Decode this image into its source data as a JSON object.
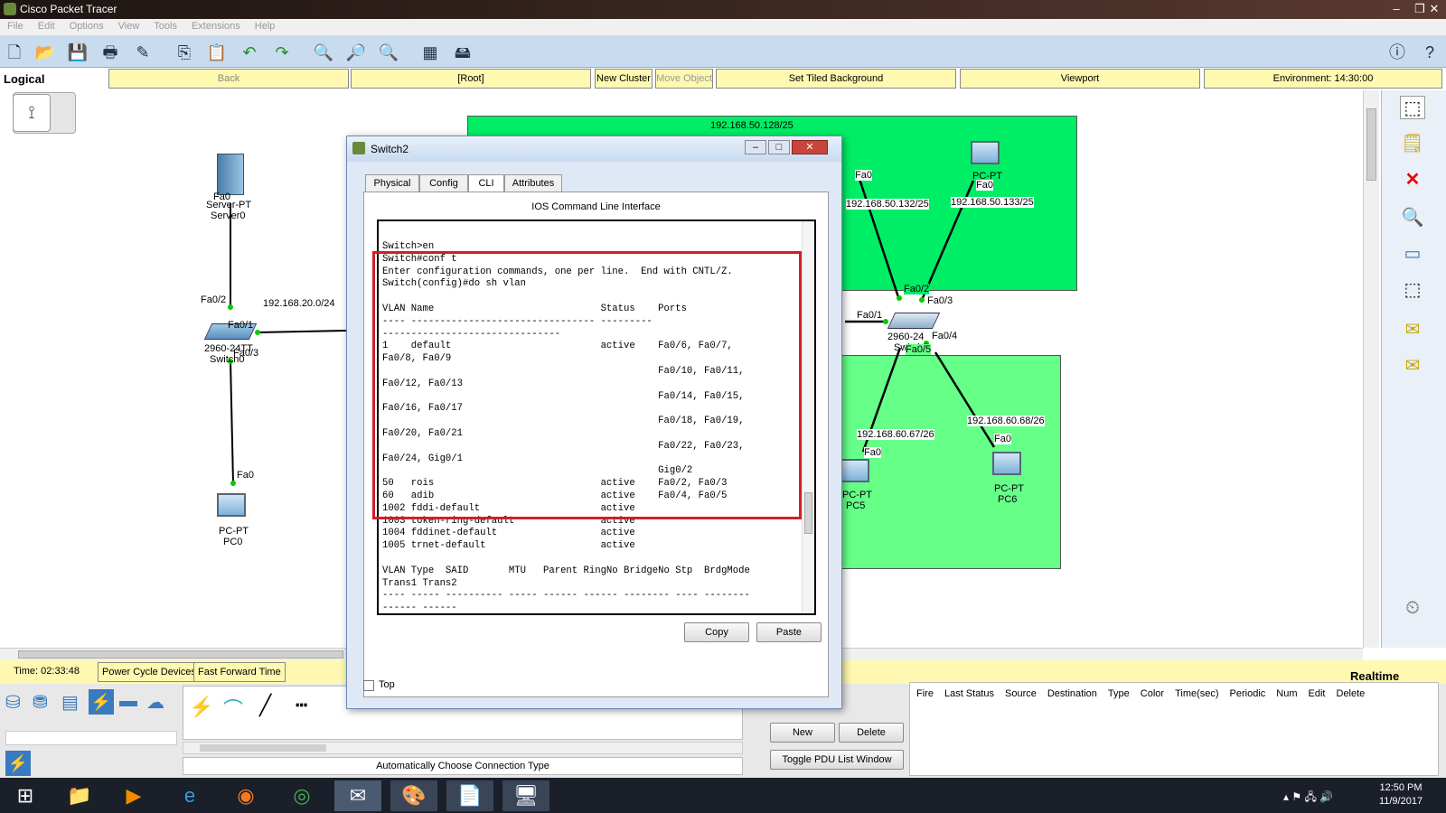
{
  "window": {
    "title": "Cisco Packet Tracer",
    "controls": [
      "–",
      "❐",
      "✕"
    ]
  },
  "menu": [
    "File",
    "Edit",
    "Options",
    "View",
    "Tools",
    "Extensions",
    "Help"
  ],
  "toolbar_icons": [
    "new-file-icon",
    "open-folder-icon",
    "save-icon",
    "print-icon",
    "activity-wizard-icon",
    "copy-icon",
    "paste-icon",
    "undo-icon",
    "redo-icon",
    "zoom-in-icon",
    "zoom-reset-icon",
    "zoom-out-icon",
    "palette-icon",
    "custom-device-icon",
    "info-icon",
    "help-icon"
  ],
  "workspace_bar": {
    "mode": "Logical",
    "back": "Back",
    "root": "[Root]",
    "new_cluster": "New Cluster",
    "move_object": "Move Object",
    "tiled_bg": "Set Tiled Background",
    "viewport": "Viewport",
    "environment": "Environment: 14:30:00"
  },
  "topology": {
    "server": {
      "port": "Fa0",
      "type": "Server-PT",
      "name": "Server0"
    },
    "switch0": {
      "port_fa02": "Fa0/2",
      "port_fa01": "Fa0/1",
      "port_fa03": "Fa0/3",
      "type": "2960-24TT",
      "name": "Switch0",
      "net": "192.168.20.0/24"
    },
    "pc0": {
      "port": "Fa0",
      "type": "PC-PT",
      "name": "PC0"
    },
    "zone_top_net": "192.168.50.128/25",
    "pc_top_left": {
      "port": "Fa0",
      "ip": "192.168.50.132/25"
    },
    "pc_top_right": {
      "port": "Fa0",
      "type": "PC-PT",
      "ip": "192.168.50.133/25"
    },
    "switch2": {
      "fa02": "Fa0/2",
      "fa03": "Fa0/3",
      "fa01": "Fa0/1",
      "fa04": "Fa0/4",
      "fa05": "Fa0/5",
      "type": "2960-24",
      "name": "Switch2"
    },
    "pc5": {
      "ip": "192.168.60.67/26",
      "port": "Fa0",
      "type": "PC-PT",
      "name": "PC5"
    },
    "pc6": {
      "ip": "192.168.60.68/26",
      "port": "Fa0",
      "type": "PC-PT",
      "name": "PC6"
    }
  },
  "dialog": {
    "title": "Switch2",
    "tabs": [
      "Physical",
      "Config",
      "CLI",
      "Attributes"
    ],
    "active_tab": "CLI",
    "heading": "IOS Command Line Interface",
    "cli_text": "Switch>en\nSwitch#conf t\nEnter configuration commands, one per line.  End with CNTL/Z.\nSwitch(config)#do sh vlan\n\nVLAN Name                             Status    Ports\n---- -------------------------------- --------- \n-------------------------------\n1    default                          active    Fa0/6, Fa0/7,\nFa0/8, Fa0/9\n                                                Fa0/10, Fa0/11,\nFa0/12, Fa0/13\n                                                Fa0/14, Fa0/15,\nFa0/16, Fa0/17\n                                                Fa0/18, Fa0/19,\nFa0/20, Fa0/21\n                                                Fa0/22, Fa0/23,\nFa0/24, Gig0/1\n                                                Gig0/2\n50   rois                             active    Fa0/2, Fa0/3\n60   adib                             active    Fa0/4, Fa0/5\n1002 fddi-default                     active\n1003 token-ring-default               active\n1004 fddinet-default                  active\n1005 trnet-default                    active\n\nVLAN Type  SAID       MTU   Parent RingNo BridgeNo Stp  BrdgMode\nTrans1 Trans2\n---- ----- ---------- ----- ------ ------ -------- ---- --------\n------ ------",
    "copy": "Copy",
    "paste": "Paste",
    "top_checkbox": "Top",
    "top_checked": false
  },
  "bottom": {
    "time": "Time: 02:33:48",
    "power_cycle": "Power Cycle Devices",
    "fast_forward": "Fast Forward Time",
    "connection_label": "Automatically Choose Connection Type",
    "realtime": "Realtime",
    "scenario_new": "New",
    "scenario_delete": "Delete",
    "toggle_pdu": "Toggle PDU List Window",
    "pdu_columns": [
      "Fire",
      "Last Status",
      "Source",
      "Destination",
      "Type",
      "Color",
      "Time(sec)",
      "Periodic",
      "Num",
      "Edit",
      "Delete"
    ]
  },
  "taskbar": {
    "time": "12:50 PM",
    "date": "11/9/2017"
  },
  "colors": {
    "zone_top": "#00ee66",
    "zone_bottom": "#66ff88",
    "highlight": "#d21e2a",
    "yellow": "#fff8b0"
  }
}
